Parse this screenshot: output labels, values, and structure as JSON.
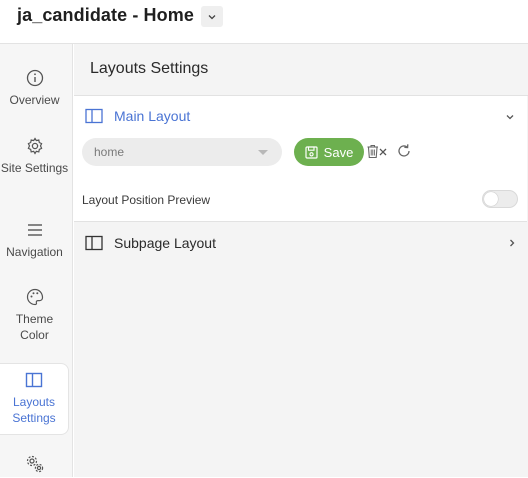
{
  "app": {
    "title": "ja_candidate - Home"
  },
  "sidebar": {
    "items": [
      {
        "label": "Overview",
        "icon": "info-icon"
      },
      {
        "label": "Site Settings",
        "icon": "gear-icon"
      },
      {
        "label": "Navigation",
        "icon": "hamburger-menu-icon"
      },
      {
        "label": "Theme Color",
        "icon": "palette-icon"
      },
      {
        "label": "Layouts Settings",
        "icon": "layout-columns-icon",
        "active": true
      },
      {
        "label": "",
        "icon": "gears-icon"
      }
    ]
  },
  "main": {
    "title": "Layouts Settings",
    "main_layout": {
      "title": "Main Layout",
      "select_value": "home",
      "save_label": "Save",
      "preview_label": "Layout Position Preview",
      "preview_enabled": false
    },
    "subpage_layout": {
      "title": "Subpage Layout"
    }
  },
  "colors": {
    "accent": "#4a74d4",
    "save": "#6db04f"
  }
}
